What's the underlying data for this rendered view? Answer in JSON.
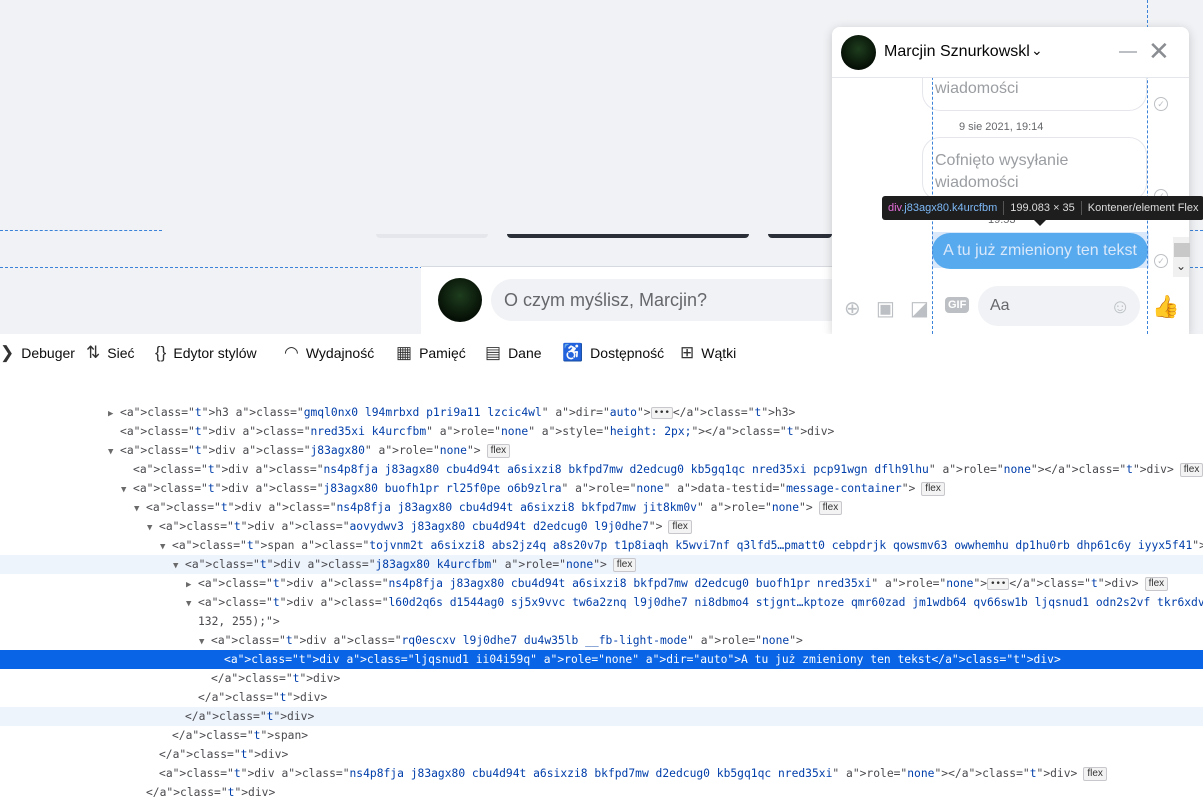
{
  "composer": {
    "placeholder": "O czym myślisz, Marcjin?"
  },
  "chat": {
    "contact_name": "Marcjin Sznurkowskl",
    "partial_message_top": "wiadomości",
    "timestamp": "9 sie 2021, 19:14",
    "recalled_line1": "Cofnięto wysyłanie",
    "recalled_line2": "wiadomości",
    "partial_timestamp": "19:53",
    "message": "A tu już zmieniony ten tekst",
    "input_placeholder": "Aa"
  },
  "inspector_tooltip": {
    "tag": "div",
    "classes": ".j83agx80.k4urcfbm",
    "size": "199.083 × 35",
    "type": "Kontener/element Flex"
  },
  "devtools": {
    "tabs": [
      {
        "icon": "debugger-icon",
        "label": "Debuger"
      },
      {
        "icon": "network-icon",
        "label": "Sieć"
      },
      {
        "icon": "style-editor-icon",
        "label": "Edytor stylów"
      },
      {
        "icon": "performance-icon",
        "label": "Wydajność"
      },
      {
        "icon": "memory-icon",
        "label": "Pamięć"
      },
      {
        "icon": "storage-icon",
        "label": "Dane"
      },
      {
        "icon": "accessibility-icon",
        "label": "Dostępność"
      },
      {
        "icon": "threads-icon",
        "label": "Wątki"
      }
    ],
    "flex_badge": "flex"
  },
  "markup_lines": [
    {
      "text": "<h3 class=\"gmql0nx0 l94mrbxd p1ri9a11 lzcic4wl\" dir=\"auto\">…</h3>"
    },
    {
      "text": "<div class=\"nred35xi k4urcfbm\" role=\"none\" style=\"height: 2px;\"></div>"
    },
    {
      "text": "<div class=\"j83agx80\" role=\"none\">"
    },
    {
      "text": "<div class=\"ns4p8fja j83agx80 cbu4d94t a6sixzi8 bkfpd7mw d2edcug0 kb5gq1qc nred35xi pcp91wgn dflh9lhu\" role=\"none\"></div>"
    },
    {
      "text": "<div class=\"j83agx80 buofh1pr rl25f0pe o6b9zlra\" role=\"none\" data-testid=\"message-container\">"
    },
    {
      "text": "<div class=\"ns4p8fja j83agx80 cbu4d94t a6sixzi8 bkfpd7mw jit8km0v\" role=\"none\">"
    },
    {
      "text": "<div class=\"aovydwv3 j83agx80 cbu4d94t d2edcug0 l9j0dhe7\">"
    },
    {
      "text": "<span class=\"tojvnm2t a6sixzi8 abs2jz4q a8s20v7p t1p8iaqh k5wvi7nf q3lfd5…pmatt0 cebpdrjk qowsmv63 owwhemhu dp1hu0rb dhp61c6y iyyx5f41\">"
    },
    {
      "text": "<div class=\"j83agx80 k4urcfbm\" role=\"none\">"
    },
    {
      "text": "<div class=\"ns4p8fja j83agx80 cbu4d94t a6sixzi8 bkfpd7mw d2edcug0 buofh1pr nred35xi\" role=\"none\">…</div>"
    },
    {
      "text": "<div class=\"l60d2q6s d1544ag0 sj5x9vvc tw6a2znq l9j0dhe7 ni8dbmo4 stjgnt…kptoze qmr60zad jm1wdb64 qv66sw1b ljqsnud1 odn2s2vf tkr6xdv7\" role=\"none\""
    },
    {
      "text": "132, 255);\">"
    },
    {
      "text": "<div class=\"rq0escxv l9j0dhe7 du4w35lb __fb-light-mode\" role=\"none\">"
    },
    {
      "text": "<div class=\"ljqsnud1 ii04i59q\" role=\"none\" dir=\"auto\">A tu już zmieniony ten tekst</div>"
    },
    {
      "text": "</div>"
    },
    {
      "text": "</div>"
    },
    {
      "text": "</div>"
    },
    {
      "text": "</span>"
    },
    {
      "text": "</div>"
    },
    {
      "text": "<div class=\"ns4p8fja j83agx80 cbu4d94t a6sixzi8 bkfpd7mw d2edcug0 kb5gq1qc nred35xi\" role=\"none\"></div>"
    },
    {
      "text": "</div>"
    }
  ]
}
